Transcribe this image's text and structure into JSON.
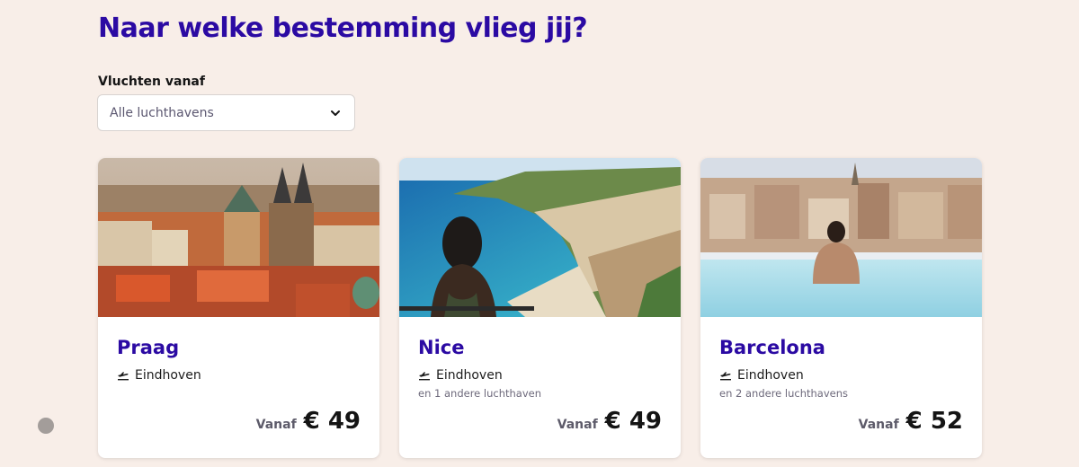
{
  "page": {
    "title": "Naar welke bestemming vlieg jij?"
  },
  "filter": {
    "label": "Vluchten vanaf",
    "selected": "Alle luchthavens",
    "icon": "chevron-down-icon"
  },
  "cards": [
    {
      "city": "Praag",
      "origin": "Eindhoven",
      "more_airports": "",
      "price_prefix": "Vanaf",
      "price": "€ 49",
      "image": "prague-cityscape-photo"
    },
    {
      "city": "Nice",
      "origin": "Eindhoven",
      "more_airports": "en 1 andere luchthaven",
      "price_prefix": "Vanaf",
      "price": "€ 49",
      "image": "nice-coastline-photo"
    },
    {
      "city": "Barcelona",
      "origin": "Eindhoven",
      "more_airports": "en 2 andere luchthavens",
      "price_prefix": "Vanaf",
      "price": "€ 52",
      "image": "barcelona-rooftop-pool-photo"
    }
  ],
  "colors": {
    "background": "#f8eee8",
    "accent": "#2b0aa3",
    "card": "#ffffff"
  }
}
